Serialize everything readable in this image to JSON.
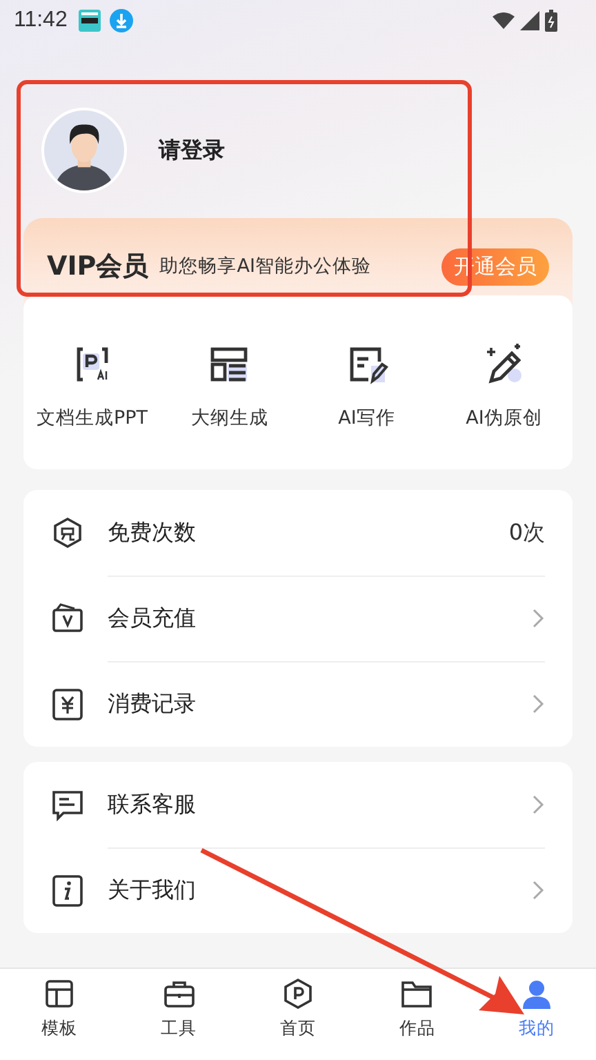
{
  "status_bar": {
    "time": "11:42"
  },
  "profile": {
    "login_prompt": "请登录"
  },
  "vip_banner": {
    "title": "VIP会员",
    "subtitle": "助您畅享AI智能办公体验",
    "button": "开通会员"
  },
  "tools": [
    {
      "label": "文档生成PPT"
    },
    {
      "label": "大纲生成"
    },
    {
      "label": "AI写作"
    },
    {
      "label": "AI伪原创"
    }
  ],
  "menu_groups": [
    [
      {
        "kind": "value",
        "label": "免费次数",
        "value": "0次"
      },
      {
        "kind": "link",
        "label": "会员充值"
      },
      {
        "kind": "link",
        "label": "消费记录"
      }
    ],
    [
      {
        "kind": "link",
        "label": "联系客服"
      },
      {
        "kind": "link",
        "label": "关于我们"
      }
    ]
  ],
  "tab_bar": [
    {
      "label": "模板",
      "selected": false
    },
    {
      "label": "工具",
      "selected": false
    },
    {
      "label": "首页",
      "selected": false
    },
    {
      "label": "作品",
      "selected": false
    },
    {
      "label": "我的",
      "selected": true
    }
  ],
  "annotations": {
    "highlight_frame": true,
    "pointer_arrow": true
  }
}
